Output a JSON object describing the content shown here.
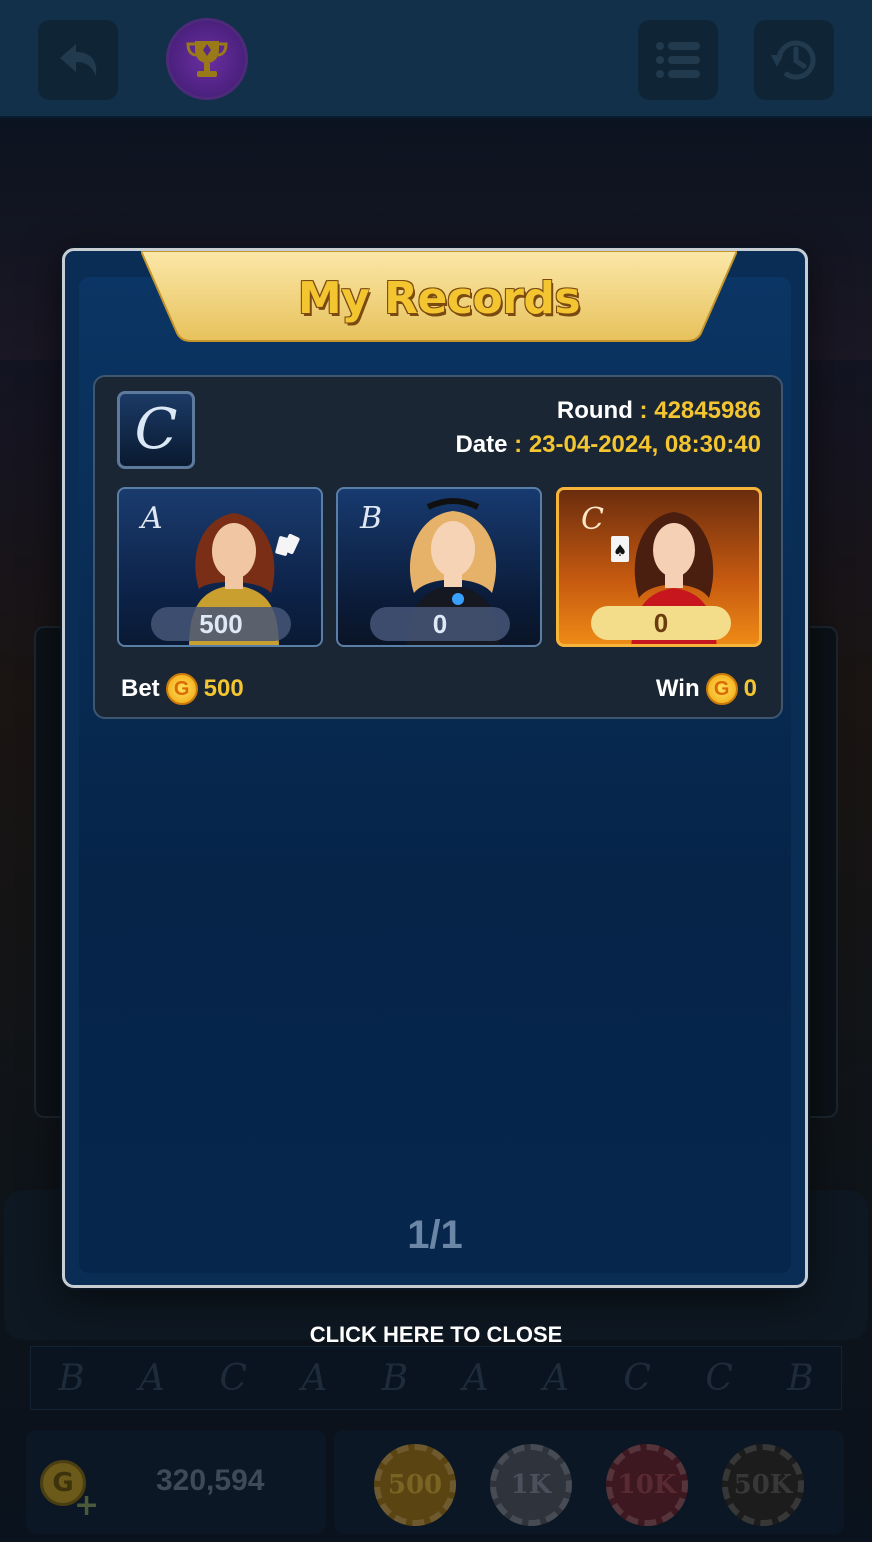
{
  "background": {
    "history_results": [
      "B",
      "A",
      "C",
      "A",
      "B",
      "A",
      "A",
      "C",
      "C",
      "B"
    ],
    "balance": "320,594",
    "chips": [
      {
        "label": "500",
        "color": "#6b5210"
      },
      {
        "label": "1K",
        "color": "#3a3f4a"
      },
      {
        "label": "10K",
        "color": "#4a1a22"
      },
      {
        "label": "50K",
        "color": "#222222"
      }
    ],
    "icons": {
      "back": "back-arrow-icon",
      "trophy": "trophy-icon",
      "menu": "menu-list-icon",
      "history": "history-clock-icon"
    }
  },
  "modal": {
    "title": "My Records",
    "record": {
      "result": "C",
      "round_label": "Round",
      "round_value": "42845986",
      "date_label": "Date",
      "date_value": "23-04-2024, 08:30:40",
      "players": [
        {
          "letter": "A",
          "bet": "500"
        },
        {
          "letter": "B",
          "bet": "0"
        },
        {
          "letter": "C",
          "bet": "0"
        }
      ],
      "bet_label": "Bet",
      "bet_value": "500",
      "win_label": "Win",
      "win_value": "0",
      "coin_symbol": "G"
    },
    "pagination": "1/1"
  },
  "close_hint": "CLICK HERE TO CLOSE",
  "colors": {
    "gold": "#f3c531",
    "panel": "#0a2d55",
    "winner": "#ee8a16"
  }
}
